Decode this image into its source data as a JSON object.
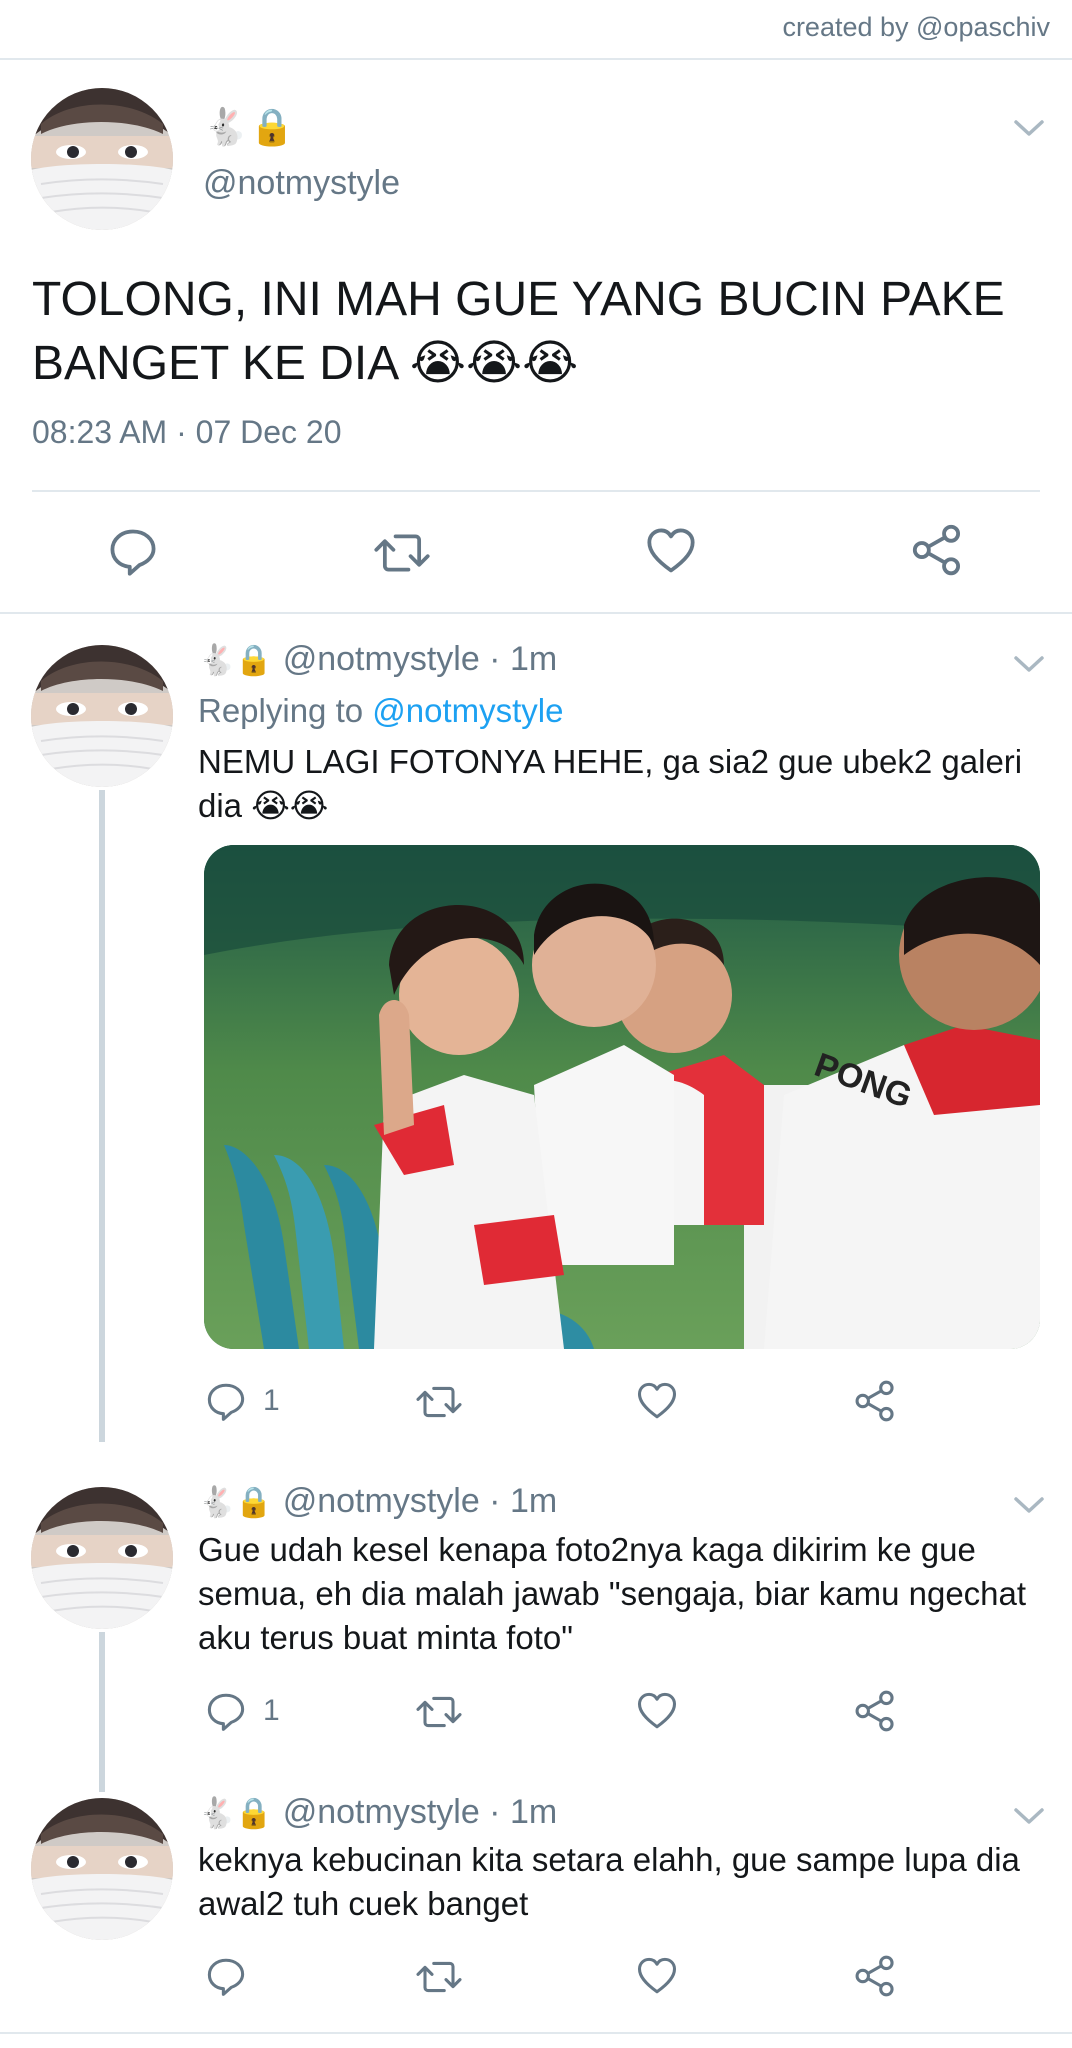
{
  "credit": "created by @opaschiv",
  "main_tweet": {
    "name_emoji": "🐇🔒",
    "handle": "@notmystyle",
    "text": "TOLONG, INI MAH GUE YANG BUCIN PAKE BANGET KE DIA 😭😭😭",
    "timestamp": "08:23 AM · 07 Dec 20",
    "actions": [
      "reply-icon",
      "retweet-icon",
      "like-icon",
      "share-icon"
    ]
  },
  "replies": [
    {
      "name_emoji": "🐇🔒",
      "meta": "@notmystyle · 1m",
      "replying_prefix": "Replying to ",
      "replying_handle": "@notmystyle",
      "text": "NEMU LAGI FOTONYA HEHE, ga sia2 gue ubek2 galeri dia 😭😭",
      "photo_text": "PONG",
      "reply_count": "1"
    },
    {
      "name_emoji": "🐇🔒",
      "meta": "@notmystyle · 1m",
      "text": "Gue udah kesel kenapa foto2nya kaga dikirim ke gue semua, eh dia malah jawab \"sengaja, biar kamu ngechat aku terus buat minta foto\"",
      "reply_count": "1"
    },
    {
      "name_emoji": "🐇🔒",
      "meta": "@notmystyle · 1m",
      "text": "keknya kebucinan kita setara elahh, gue sampe lupa dia awal2 tuh cuek banget",
      "reply_count": ""
    }
  ],
  "colors": {
    "text": "#14171a",
    "secondary": "#657786",
    "link": "#1da1f2",
    "divider": "#e1e8ed",
    "thread_line": "#ccd6dd"
  }
}
